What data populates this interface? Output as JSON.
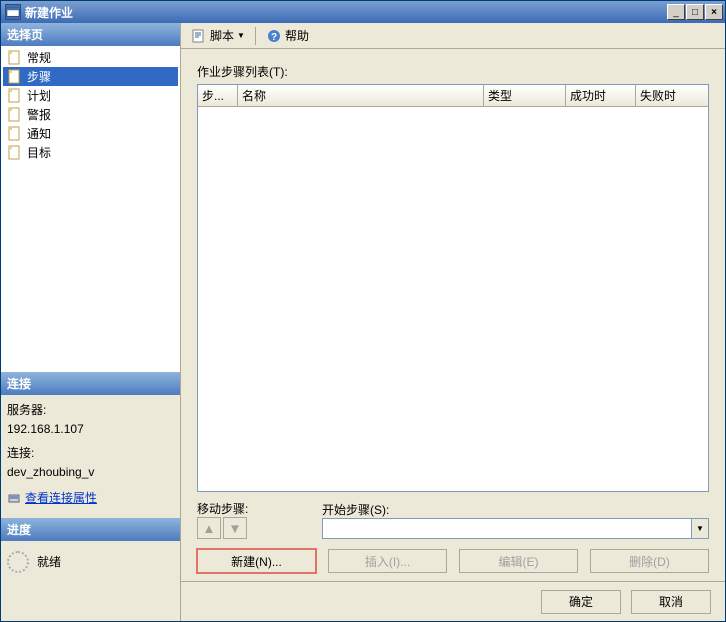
{
  "window": {
    "title": "新建作业"
  },
  "leftpane": {
    "select_header": "选择页",
    "nav": [
      {
        "label": "常规"
      },
      {
        "label": "步骤"
      },
      {
        "label": "计划"
      },
      {
        "label": "警报"
      },
      {
        "label": "通知"
      },
      {
        "label": "目标"
      }
    ],
    "nav_selected_index": 1,
    "conn": {
      "header": "连接",
      "server_label": "服务器:",
      "server": "192.168.1.107",
      "connection_label": "连接:",
      "connection": "dev_zhoubing_v",
      "view_props": "查看连接属性"
    },
    "progress": {
      "header": "进度",
      "status": "就绪"
    }
  },
  "toolbar": {
    "script": "脚本",
    "help": "帮助"
  },
  "main": {
    "list_label": "作业步骤列表(T):",
    "columns": {
      "step": "步...",
      "name": "名称",
      "type": "类型",
      "ok": "成功时",
      "fail": "失败时"
    },
    "move_label": "移动步骤:",
    "start_label": "开始步骤(S):",
    "start_value": "",
    "buttons": {
      "new": "新建(N)...",
      "insert": "插入(I)...",
      "edit": "编辑(E)",
      "delete": "删除(D)"
    }
  },
  "footer": {
    "ok": "确定",
    "cancel": "取消"
  }
}
